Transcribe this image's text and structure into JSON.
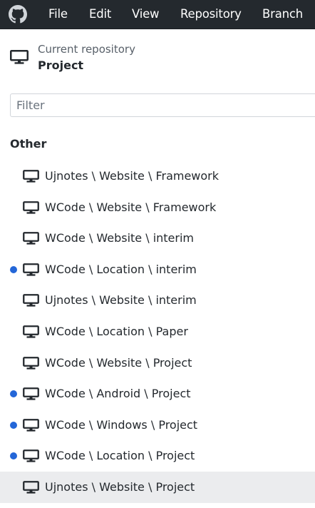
{
  "menubar": {
    "logo_icon": "github-logo-icon",
    "items": [
      {
        "label": "File"
      },
      {
        "label": "Edit"
      },
      {
        "label": "View"
      },
      {
        "label": "Repository"
      },
      {
        "label": "Branch"
      }
    ]
  },
  "repo_header": {
    "caption": "Current repository",
    "name": "Project",
    "icon": "monitor-icon"
  },
  "filter": {
    "placeholder": "Filter",
    "value": ""
  },
  "section": {
    "heading": "Other",
    "indicator_color": "#2366d8",
    "items": [
      {
        "label": "Ujnotes \\ Website \\ Framework",
        "has_changes": false,
        "selected": false
      },
      {
        "label": "WCode \\ Website \\ Framework",
        "has_changes": false,
        "selected": false
      },
      {
        "label": "WCode \\ Website \\ interim",
        "has_changes": false,
        "selected": false
      },
      {
        "label": "WCode \\ Location \\ interim",
        "has_changes": true,
        "selected": false
      },
      {
        "label": "Ujnotes \\ Website \\ interim",
        "has_changes": false,
        "selected": false
      },
      {
        "label": "WCode \\ Location \\ Paper",
        "has_changes": false,
        "selected": false
      },
      {
        "label": "WCode \\ Website \\ Project",
        "has_changes": false,
        "selected": false
      },
      {
        "label": "WCode \\ Android \\ Project",
        "has_changes": true,
        "selected": false
      },
      {
        "label": "WCode \\ Windows \\ Project",
        "has_changes": true,
        "selected": false
      },
      {
        "label": "WCode \\ Location \\ Project",
        "has_changes": true,
        "selected": false
      },
      {
        "label": "Ujnotes \\ Website \\ Project",
        "has_changes": false,
        "selected": true
      }
    ]
  }
}
